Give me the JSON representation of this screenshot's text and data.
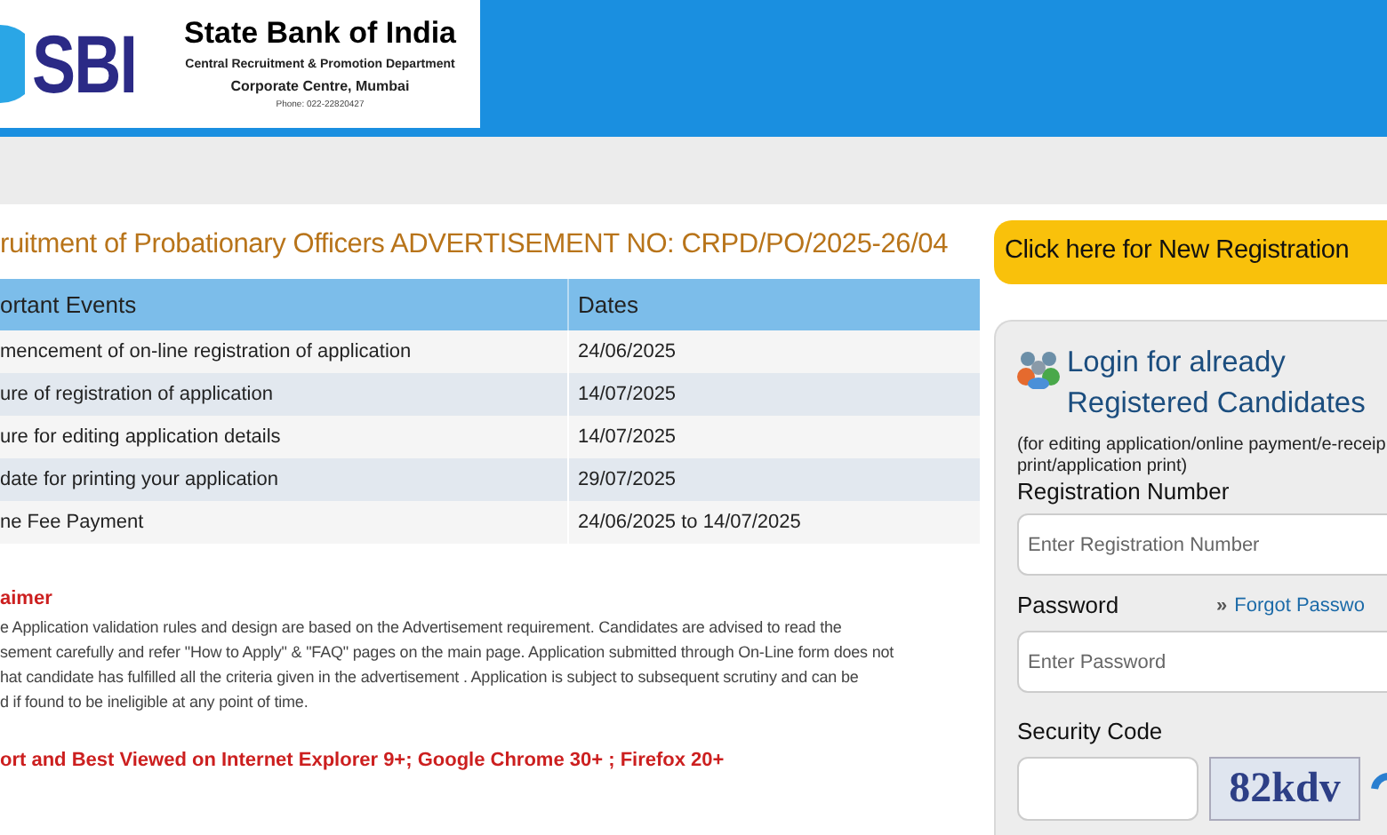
{
  "header": {
    "logo_text": "SBI",
    "bank_name": "State Bank of India",
    "department": "Central Recruitment & Promotion Department",
    "office": "Corporate Centre, Mumbai",
    "phone": "Phone: 022-22820427"
  },
  "title": "ruitment of Probationary Officers ADVERTISEMENT NO: CRPD/PO/2025-26/04",
  "events_table": {
    "columns": [
      "ortant Events",
      "Dates"
    ],
    "rows": [
      [
        "mencement of on-line registration of application",
        "24/06/2025"
      ],
      [
        "ure of registration of application",
        "14/07/2025"
      ],
      [
        "ure for editing application details",
        "14/07/2025"
      ],
      [
        "date for printing your application",
        "29/07/2025"
      ],
      [
        "ne Fee Payment",
        "24/06/2025 to 14/07/2025"
      ]
    ]
  },
  "disclaimer": {
    "heading": "aimer",
    "lines": [
      "e Application validation rules and design are based on the Advertisement requirement. Candidates are advised to read the",
      "sement carefully and refer \"How to Apply\" & \"FAQ\" pages on the main page. Application submitted through On-Line form does not",
      "hat candidate has fulfilled all the criteria given in the advertisement . Application is subject to subsequent scrutiny and can be",
      "d if found to be ineligible at any point of time."
    ]
  },
  "browser_note": "ort and Best Viewed on Internet Explorer 9+; Google Chrome 30+ ; Firefox 20+",
  "new_registration_button": "Click here for New Registration",
  "login": {
    "title_lines": [
      "Login for already",
      "Registered Candidates"
    ],
    "subtitle": "(for editing application/online payment/e-receip print/application print)",
    "registration_label": "Registration Number",
    "registration_placeholder": "Enter Registration Number",
    "password_label": "Password",
    "forgot_link_icon": "»",
    "forgot_link": "Forgot Passwo",
    "password_placeholder": "Enter Password",
    "security_label": "Security Code",
    "captcha_text": "82kdv"
  }
}
